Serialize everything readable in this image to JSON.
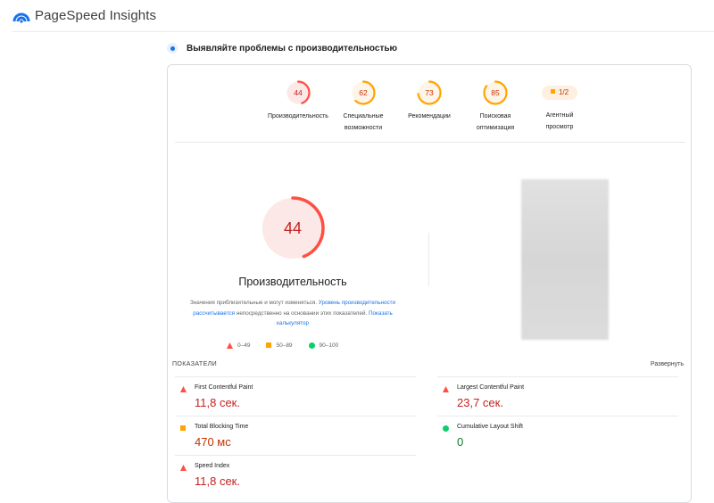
{
  "app": {
    "title": "PageSpeed Insights"
  },
  "section": {
    "title": "Выявляйте проблемы с производительностью"
  },
  "colors": {
    "fail": "#ff4e42",
    "fail_text": "#c5221f",
    "average": "#ffa400",
    "average_text": "#c33300",
    "pass": "#0cce6b",
    "pass_text": "#0d7a2f",
    "link": "#1a73e8"
  },
  "gauges": [
    {
      "score": "44",
      "label": "Производительность",
      "rating": "fail",
      "fraction": 0.44
    },
    {
      "score": "62",
      "label": "Специальные возможности",
      "rating": "average",
      "fraction": 0.62
    },
    {
      "score": "73",
      "label": "Рекомендации",
      "rating": "average",
      "fraction": 0.73
    },
    {
      "score": "85",
      "label": "Поисковая оптимизация",
      "rating": "average",
      "fraction": 0.85
    },
    {
      "score": "1/2",
      "label": "Агентный просмотр",
      "rating": "average"
    }
  ],
  "performance": {
    "score": "44",
    "fraction": 0.44,
    "title": "Производительность",
    "desc_part1": "Значения приблизительные и могут изменяться.",
    "desc_link1": "Уровень производительности рассчитывается",
    "desc_part2": "непосредственно на основании этих показателей.",
    "desc_link2": "Показать калькулятор"
  },
  "legend": [
    {
      "range": "0–49",
      "shape": "triangle-icon",
      "rating": "fail"
    },
    {
      "range": "50–89",
      "shape": "square-icon",
      "rating": "average"
    },
    {
      "range": "90–100",
      "shape": "circle-icon",
      "rating": "pass"
    }
  ],
  "metrics": {
    "title": "ПОКАЗАТЕЛИ",
    "expand_label": "Развернуть",
    "items": [
      {
        "name": "First Contentful Paint",
        "value": "11,8 сек.",
        "rating": "fail",
        "icon": "triangle-icon"
      },
      {
        "name": "Largest Contentful Paint",
        "value": "23,7 сек.",
        "rating": "fail",
        "icon": "triangle-icon"
      },
      {
        "name": "Total Blocking Time",
        "value": "470 мс",
        "rating": "average",
        "icon": "square-icon"
      },
      {
        "name": "Cumulative Layout Shift",
        "value": "0",
        "rating": "pass",
        "icon": "circle-icon"
      },
      {
        "name": "Speed Index",
        "value": "11,8 сек.",
        "rating": "fail",
        "icon": "triangle-icon"
      }
    ]
  }
}
